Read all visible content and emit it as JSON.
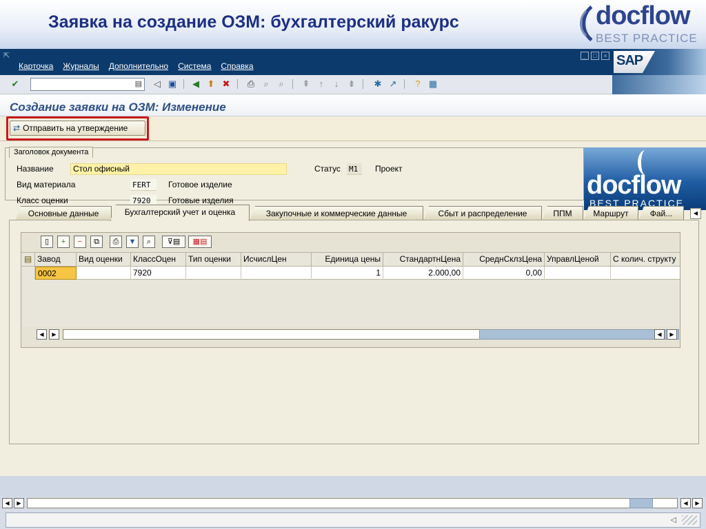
{
  "slide": {
    "title": "Заявка на создание ОЗМ: бухгалтерский ракурс",
    "logo_main": "docflow",
    "logo_sub": "BEST PRACTICE"
  },
  "sap": {
    "menu": [
      "Карточка",
      "Журналы",
      "Дополнительно",
      "Система",
      "Справка"
    ],
    "brand": "SAP",
    "command_field": "",
    "screen_title": "Создание заявки на ОЗМ: Изменение",
    "send_button_label": "Отправить на утверждение"
  },
  "document_header": {
    "group_title": "Заголовок документа",
    "name_label": "Название",
    "name_value": "Стол офисный",
    "material_type_label": "Вид материала",
    "material_type_code": "FERT",
    "material_type_text": "Готовое изделие",
    "valuation_class_label": "Класс оценки",
    "valuation_class_code": "7920",
    "valuation_class_text": "Готовые изделия",
    "status_label": "Статус",
    "status_code": "M1",
    "status_text": "Проект"
  },
  "embedded_logo": {
    "main": "docflow",
    "sub": "BEST PRACTICE"
  },
  "tabs": [
    {
      "label": "Основные данные",
      "active": false
    },
    {
      "label": "Бухгалтерский учет и оценка",
      "active": true
    },
    {
      "label": "Закупочные и коммерческие данные",
      "active": false
    },
    {
      "label": "Сбыт и распределение",
      "active": false
    },
    {
      "label": "ППМ",
      "active": false
    },
    {
      "label": "Маршрут",
      "active": false
    },
    {
      "label": "Фай...",
      "active": false
    }
  ],
  "grid": {
    "columns": [
      "Завод",
      "Вид оценки",
      "КлассОцен",
      "Тип оценки",
      "ИсчислЦен",
      "Единица цены",
      "СтандартнЦена",
      "СреднСклзЦена",
      "УправлЦеной",
      "С колич. структу"
    ],
    "rows": [
      [
        "0002",
        "",
        "7920",
        "",
        "",
        "1",
        "2.000,00",
        "0,00",
        "",
        ""
      ]
    ]
  },
  "icons": {
    "ok": "check-circle-icon",
    "save": "save-icon",
    "back": "back-arrow-icon",
    "exit": "exit-icon",
    "cancel": "cancel-icon",
    "print": "print-icon",
    "find": "find-icon",
    "help": "help-icon"
  },
  "colors": {
    "title_blue": "#1c2f86",
    "sap_blue": "#0c3a6c",
    "highlight_red": "#c8181c",
    "field_yellow": "#fff2a8",
    "cell_orange": "#f6c544"
  }
}
